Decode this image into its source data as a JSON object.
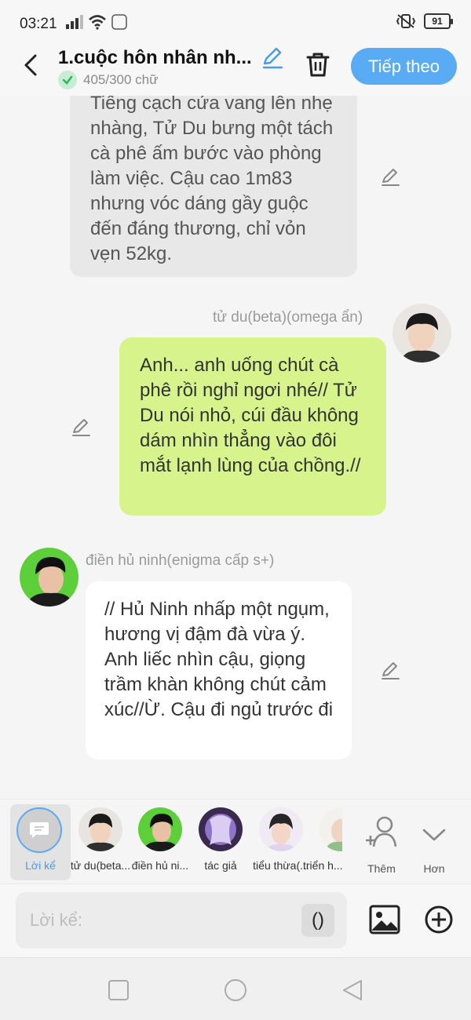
{
  "status_bar": {
    "time": "03:21",
    "battery": "91"
  },
  "header": {
    "title": "1.cuộc hôn nhân nh...",
    "char_count": "405/300 chữ",
    "next_label": "Tiếp theo"
  },
  "messages": {
    "narration": "Tiếng cạch cửa vang lên nhẹ nhàng, Tử Du bưng một tách cà phê ấm bước vào phòng làm việc. Cậu cao 1m83 nhưng vóc dáng gầy guộc đến đáng thương, chỉ vỏn vẹn 52kg.",
    "right_speaker": "tử du(beta)(omega ẩn)",
    "right_text": "Anh... anh uống chút cà phê rồi nghỉ ngơi nhé// Tử Du nói nhỏ, cúi đầu không dám nhìn thẳng vào đôi mắt lạnh lùng của chồng.//",
    "left_speaker": "điền hủ ninh(enigma cấp s+)",
    "left_text": "// Hủ Ninh nhấp một ngụm, hương vị đậm đà vừa ý. Anh liếc nhìn cậu, giọng trầm khàn không chút cảm xúc//Ừ. Cậu đi ngủ trước đi"
  },
  "characters": {
    "narration_label": "Lời kể",
    "items": [
      {
        "label": "tử du(beta..."
      },
      {
        "label": "điền hủ ni..."
      },
      {
        "label": "tác giả"
      },
      {
        "label": "tiểu thừa(..."
      },
      {
        "label": "triển h..."
      }
    ],
    "add_label": "Thêm",
    "more_label": "Hơn"
  },
  "input": {
    "placeholder": "Lời kể:",
    "paren_label": "()"
  },
  "colors": {
    "accent": "#59abf3",
    "right_bubble": "#d6f38c",
    "narration_bubble": "#e8e8e8"
  }
}
